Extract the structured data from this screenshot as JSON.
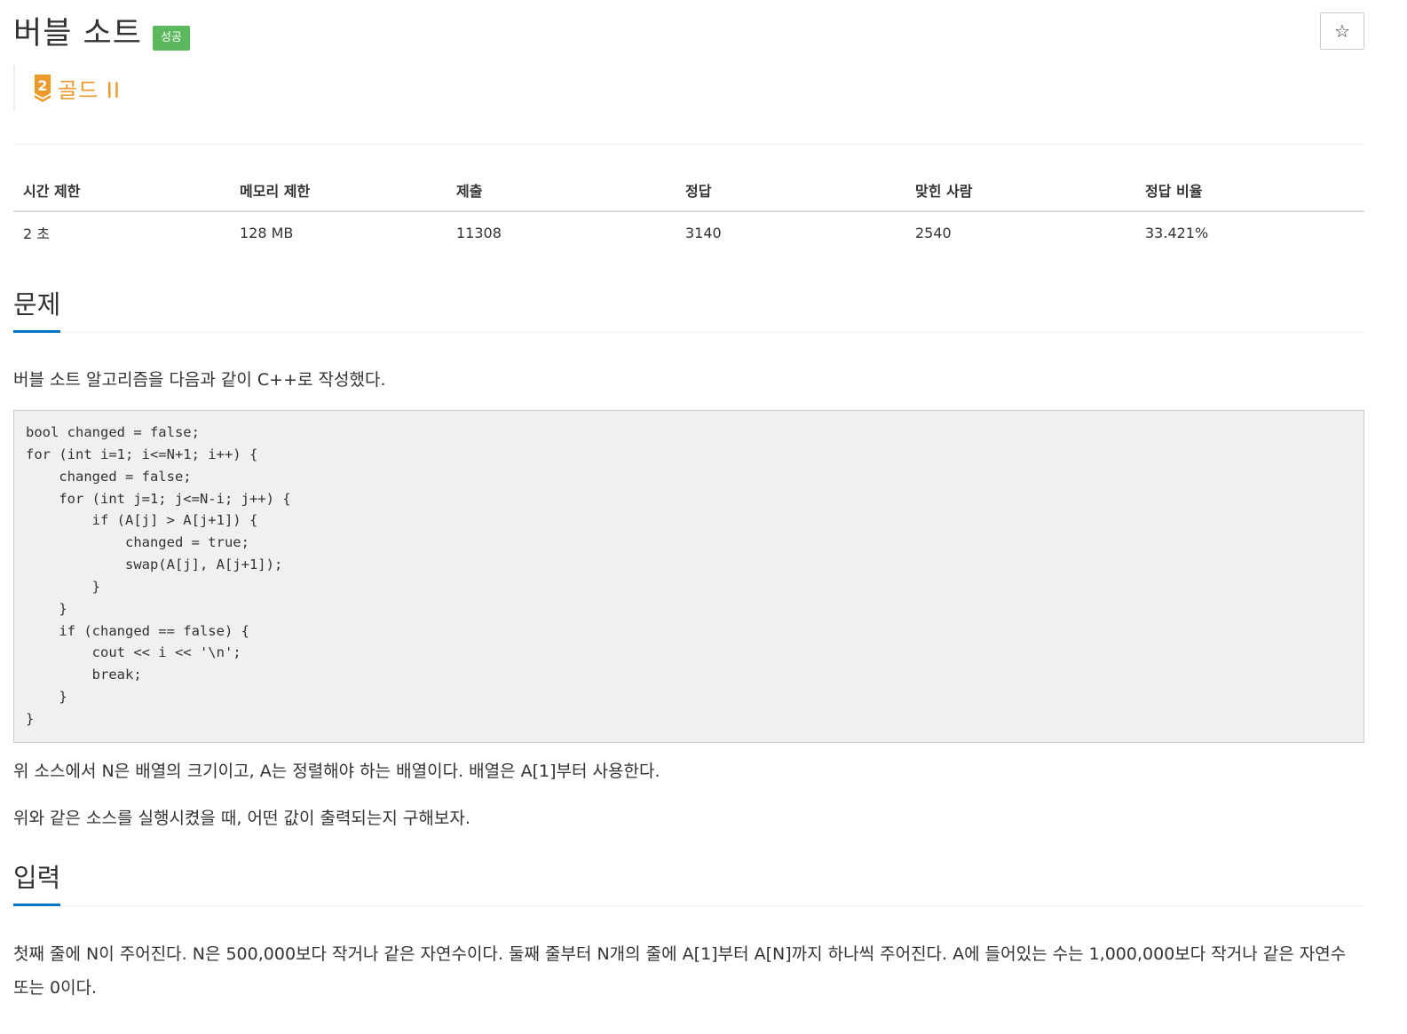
{
  "header": {
    "title": "버블 소트",
    "badge": "성공",
    "star_icon": "☆",
    "tier": {
      "icon": "gold-tier-icon",
      "number": "2",
      "label": "골드 II",
      "color": "#ec9a29"
    }
  },
  "stats": {
    "columns": [
      "시간 제한",
      "메모리 제한",
      "제출",
      "정답",
      "맞힌 사람",
      "정답 비율"
    ],
    "values": [
      "2 초",
      "128 MB",
      "11308",
      "3140",
      "2540",
      "33.421%"
    ]
  },
  "problem": {
    "heading": "문제",
    "intro": "버블 소트 알고리즘을 다음과 같이 C++로 작성했다.",
    "code": "bool changed = false;\nfor (int i=1; i<=N+1; i++) {\n    changed = false;\n    for (int j=1; j<=N-i; j++) {\n        if (A[j] > A[j+1]) {\n            changed = true;\n            swap(A[j], A[j+1]);\n        }\n    }\n    if (changed == false) {\n        cout << i << '\\n';\n        break;\n    }\n}",
    "paragraph1": "위 소스에서 N은 배열의 크기이고, A는 정렬해야 하는 배열이다. 배열은 A[1]부터 사용한다.",
    "paragraph2": "위와 같은 소스를 실행시켰을 때, 어떤 값이 출력되는지 구해보자."
  },
  "input": {
    "heading": "입력",
    "paragraph": "첫째 줄에 N이 주어진다. N은 500,000보다 작거나 같은 자연수이다. 둘째 줄부터 N개의 줄에 A[1]부터 A[N]까지 하나씩 주어진다. A에 들어있는 수는 1,000,000보다 작거나 같은 자연수 또는 0이다."
  },
  "colors": {
    "success_badge": "#5cb85c",
    "section_underline": "#0076c0",
    "code_background": "#f0f0f0"
  }
}
